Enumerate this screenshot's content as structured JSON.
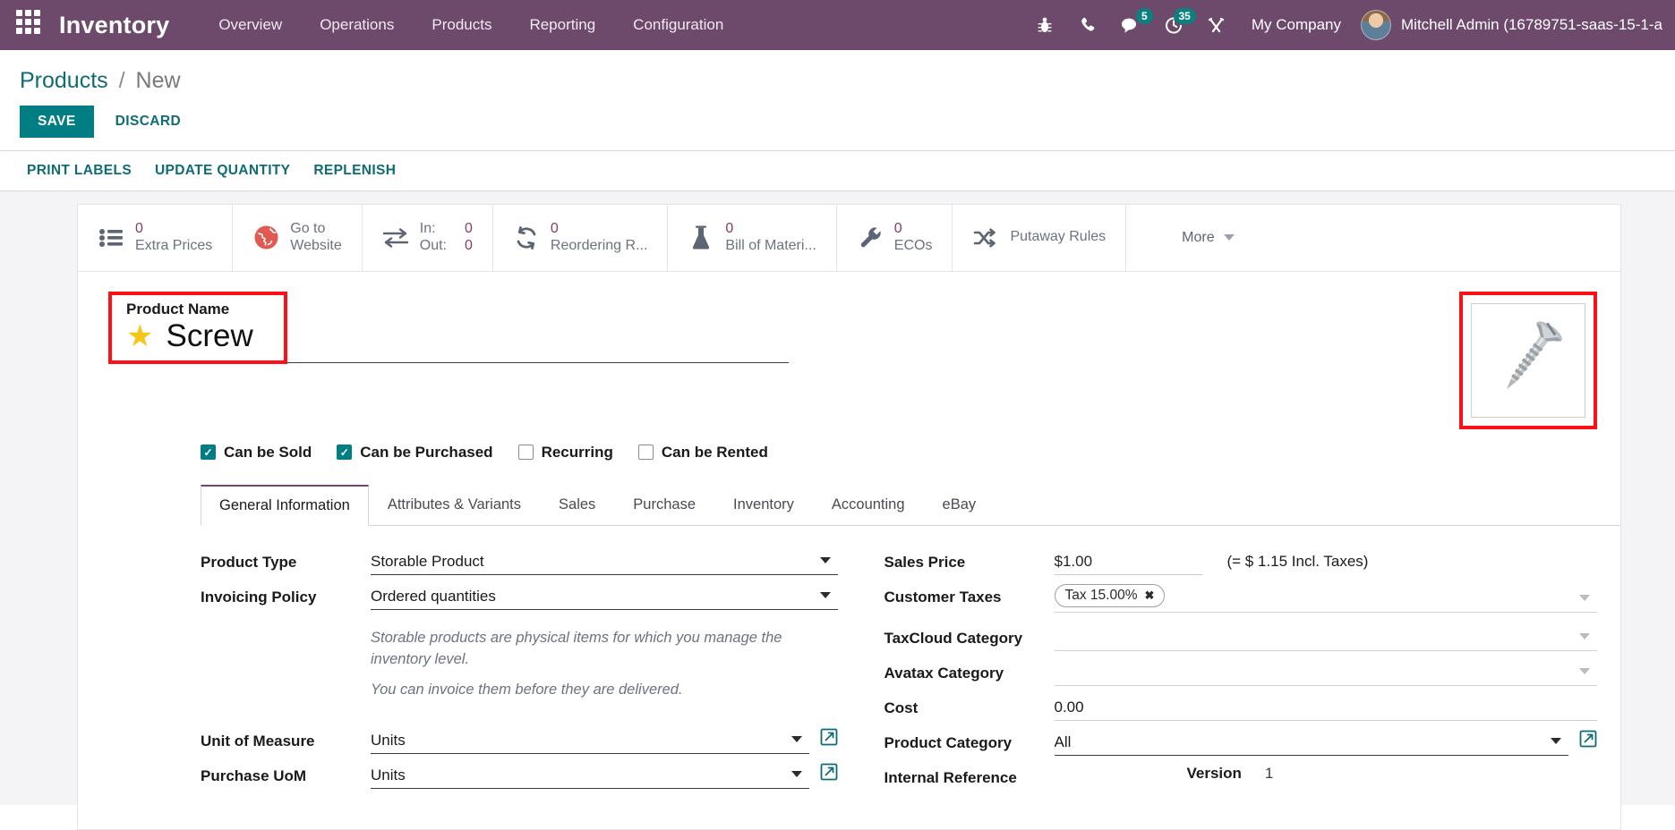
{
  "navbar": {
    "apps_icon": "apps-grid-icon",
    "brand": "Inventory",
    "menu": [
      {
        "label": "Overview"
      },
      {
        "label": "Operations"
      },
      {
        "label": "Products"
      },
      {
        "label": "Reporting"
      },
      {
        "label": "Configuration"
      }
    ],
    "icons": [
      {
        "name": "bug-icon",
        "badge": ""
      },
      {
        "name": "phone-icon",
        "badge": ""
      },
      {
        "name": "messages-icon",
        "badge": "5"
      },
      {
        "name": "activities-clock-icon",
        "badge": "35"
      },
      {
        "name": "tools-icon",
        "badge": ""
      }
    ],
    "company": "My Company",
    "user": "Mitchell Admin (16789751-saas-15-1-a",
    "avatar": "user-avatar",
    "background_color": "#6d496b"
  },
  "control_panel": {
    "breadcrumb_root": "Products",
    "breadcrumb_separator": "/",
    "breadcrumb_current": "New",
    "save_label": "SAVE",
    "discard_label": "DISCARD",
    "save_color": "#017e84"
  },
  "action_bar": {
    "buttons": [
      {
        "label": "PRINT LABELS"
      },
      {
        "label": "UPDATE QUANTITY"
      },
      {
        "label": "REPLENISH"
      }
    ]
  },
  "smart_buttons": [
    {
      "icon": "list-icon",
      "value": "0",
      "label": "Extra Prices"
    },
    {
      "icon": "globe-icon",
      "value": "",
      "label": "Go to Website",
      "label2": ""
    },
    {
      "icon": "exchange-arrows-icon",
      "label_in": "In:",
      "value_in": "0",
      "label_out": "Out:",
      "value_out": "0"
    },
    {
      "icon": "refresh-icon",
      "value": "0",
      "label": "Reordering R..."
    },
    {
      "icon": "flask-icon",
      "value": "0",
      "label": "Bill of Materi..."
    },
    {
      "icon": "wrench-icon",
      "value": "0",
      "label": "ECOs"
    },
    {
      "icon": "shuffle-icon",
      "value": "",
      "label": "Putaway Rules"
    },
    {
      "icon": "chevron-down-icon",
      "value": "",
      "label": "More"
    }
  ],
  "product": {
    "name_label": "Product Name",
    "name_value": "Screw",
    "favorite_icon": "star-filled-icon",
    "image_alt": "product-image-screw",
    "highlight_color": "#ff0f18"
  },
  "checkboxes": [
    {
      "label": "Can be Sold",
      "checked": true
    },
    {
      "label": "Can be Purchased",
      "checked": true
    },
    {
      "label": "Recurring",
      "checked": false
    },
    {
      "label": "Can be Rented",
      "checked": false
    }
  ],
  "tabs": [
    {
      "label": "General Information",
      "active": true
    },
    {
      "label": "Attributes & Variants",
      "active": false
    },
    {
      "label": "Sales",
      "active": false
    },
    {
      "label": "Purchase",
      "active": false
    },
    {
      "label": "Inventory",
      "active": false
    },
    {
      "label": "Accounting",
      "active": false
    },
    {
      "label": "eBay",
      "active": false
    }
  ],
  "general_information": {
    "left": {
      "product_type_label": "Product Type",
      "product_type_value": "Storable Product",
      "invoicing_policy_label": "Invoicing Policy",
      "invoicing_policy_value": "Ordered quantities",
      "help_line_1": "Storable products are physical items for which you manage the inventory level.",
      "help_line_2": "You can invoice them before they are delivered.",
      "uom_label": "Unit of Measure",
      "uom_value": "Units",
      "purchase_uom_label": "Purchase UoM",
      "purchase_uom_value": "Units"
    },
    "right": {
      "sales_price_label": "Sales Price",
      "sales_price_value": "$1.00",
      "sales_price_note": "(= $ 1.15 Incl. Taxes)",
      "customer_taxes_label": "Customer Taxes",
      "customer_taxes_tag": "Tax 15.00%",
      "taxcloud_label": "TaxCloud Category",
      "taxcloud_value": "",
      "avatax_label": "Avatax Category",
      "avatax_value": "",
      "cost_label": "Cost",
      "cost_value": "0.00",
      "product_category_label": "Product Category",
      "product_category_value": "All",
      "internal_reference_label": "Internal Reference",
      "internal_reference_value": "",
      "version_label": "Version",
      "version_value": "1"
    }
  }
}
